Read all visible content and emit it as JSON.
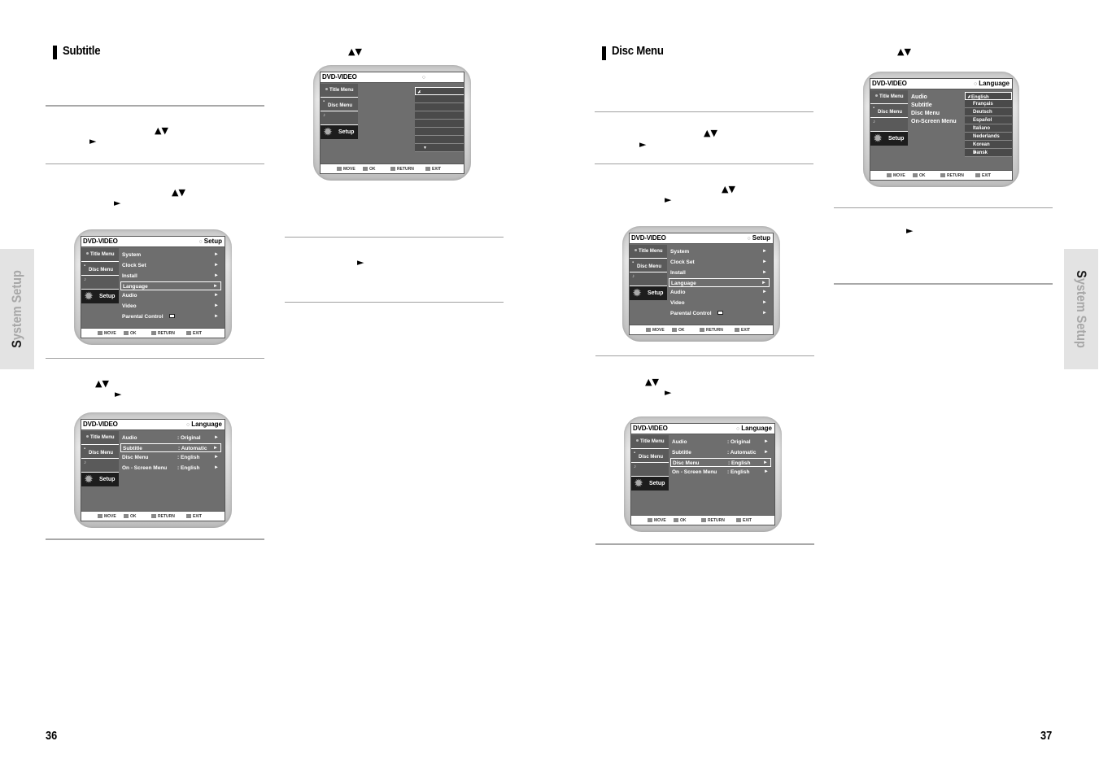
{
  "pages": {
    "left": {
      "number": "36",
      "side_tab": {
        "first_letter": "S",
        "rest": "ystem Setup"
      },
      "section_title": "Subtitle",
      "glyphs": {
        "updown": "▲▼",
        "right": "►"
      }
    },
    "right": {
      "number": "37",
      "side_tab": {
        "first_letter": "S",
        "rest": "ystem Setup"
      },
      "section_title": "Disc Menu",
      "glyphs": {
        "updown": "▲▼",
        "right": "►"
      }
    }
  },
  "osd": {
    "brand": "DVD-VIDEO",
    "nav": {
      "title_menu": "Title Menu",
      "disc_menu": "Disc Menu",
      "setup": "Setup"
    },
    "footer": {
      "move": "MOVE",
      "ok": "OK",
      "return": "RETURN",
      "exit": "EXIT"
    },
    "mode_setup": "Setup",
    "mode_language": "Language",
    "setup_menu": [
      {
        "label": "System",
        "arrow": "►"
      },
      {
        "label": "Clock Set",
        "arrow": "►"
      },
      {
        "label": "Install",
        "arrow": "►"
      },
      {
        "label": "Language",
        "arrow": "►",
        "selected": true
      },
      {
        "label": "Audio",
        "arrow": "►"
      },
      {
        "label": "Video",
        "arrow": "►"
      },
      {
        "label": "Parental Control",
        "arrow": "►"
      }
    ],
    "language_menu": [
      {
        "label": "Audio",
        "value": ": Original",
        "arrow": "►"
      },
      {
        "label": "Subtitle",
        "value": ": Automatic",
        "arrow": "►"
      },
      {
        "label": "Disc Menu",
        "value": ": English",
        "arrow": "►"
      },
      {
        "label": "On - Screen Menu",
        "value": ": English",
        "arrow": "►"
      }
    ],
    "empty_list": {
      "check": "✓",
      "up": "▲",
      "down": "▼"
    },
    "language_options": [
      "✓English",
      "Français",
      "Deutsch",
      "Español",
      "Italiano",
      "Nederlands",
      "Korean",
      "Dansk"
    ],
    "language_plain_labels": [
      "Audio",
      "Subtitle",
      "Disc Menu",
      "On-Screen Menu"
    ]
  }
}
